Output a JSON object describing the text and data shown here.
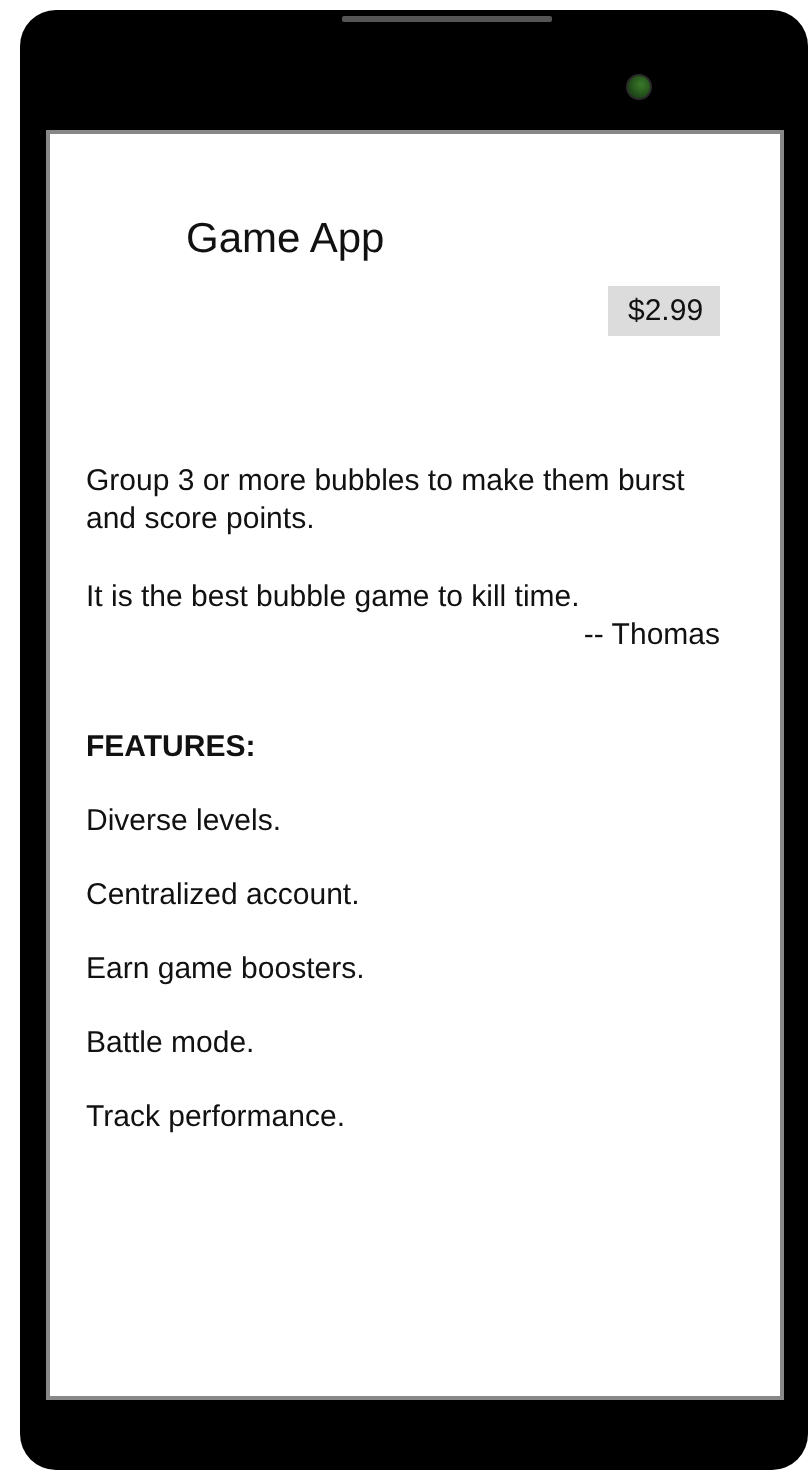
{
  "app": {
    "title": "Game App",
    "price": "$2.99"
  },
  "description": "Group 3 or more bubbles to make them burst and score points.",
  "review": {
    "quote": "It is the best bubble game to kill time.",
    "author": "-- Thomas"
  },
  "features": {
    "heading": "FEATURES:",
    "items": [
      "Diverse levels.",
      "Centralized account.",
      "Earn game boosters.",
      "Battle mode.",
      "Track performance."
    ]
  }
}
